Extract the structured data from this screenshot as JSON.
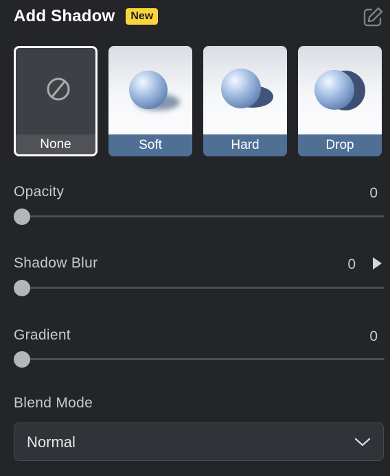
{
  "header": {
    "title": "Add Shadow",
    "badge": "New",
    "edit_icon": "edit-pencil-icon"
  },
  "presets": [
    {
      "label": "None",
      "icon": "none-icon",
      "selected": true
    },
    {
      "label": "Soft",
      "icon": "soft-shadow-sphere-icon",
      "selected": false
    },
    {
      "label": "Hard",
      "icon": "hard-shadow-sphere-icon",
      "selected": false
    },
    {
      "label": "Drop",
      "icon": "drop-shadow-sphere-icon",
      "selected": false
    }
  ],
  "sliders": {
    "opacity": {
      "label": "Opacity",
      "value": "0"
    },
    "shadow_blur": {
      "label": "Shadow Blur",
      "value": "0"
    },
    "gradient": {
      "label": "Gradient",
      "value": "0"
    }
  },
  "blend_mode": {
    "label": "Blend Mode",
    "value": "Normal"
  },
  "colors": {
    "background": "#232529",
    "badge": "#f9d53b",
    "preset_label": "#506f95",
    "selected_border": "#ffffff"
  }
}
